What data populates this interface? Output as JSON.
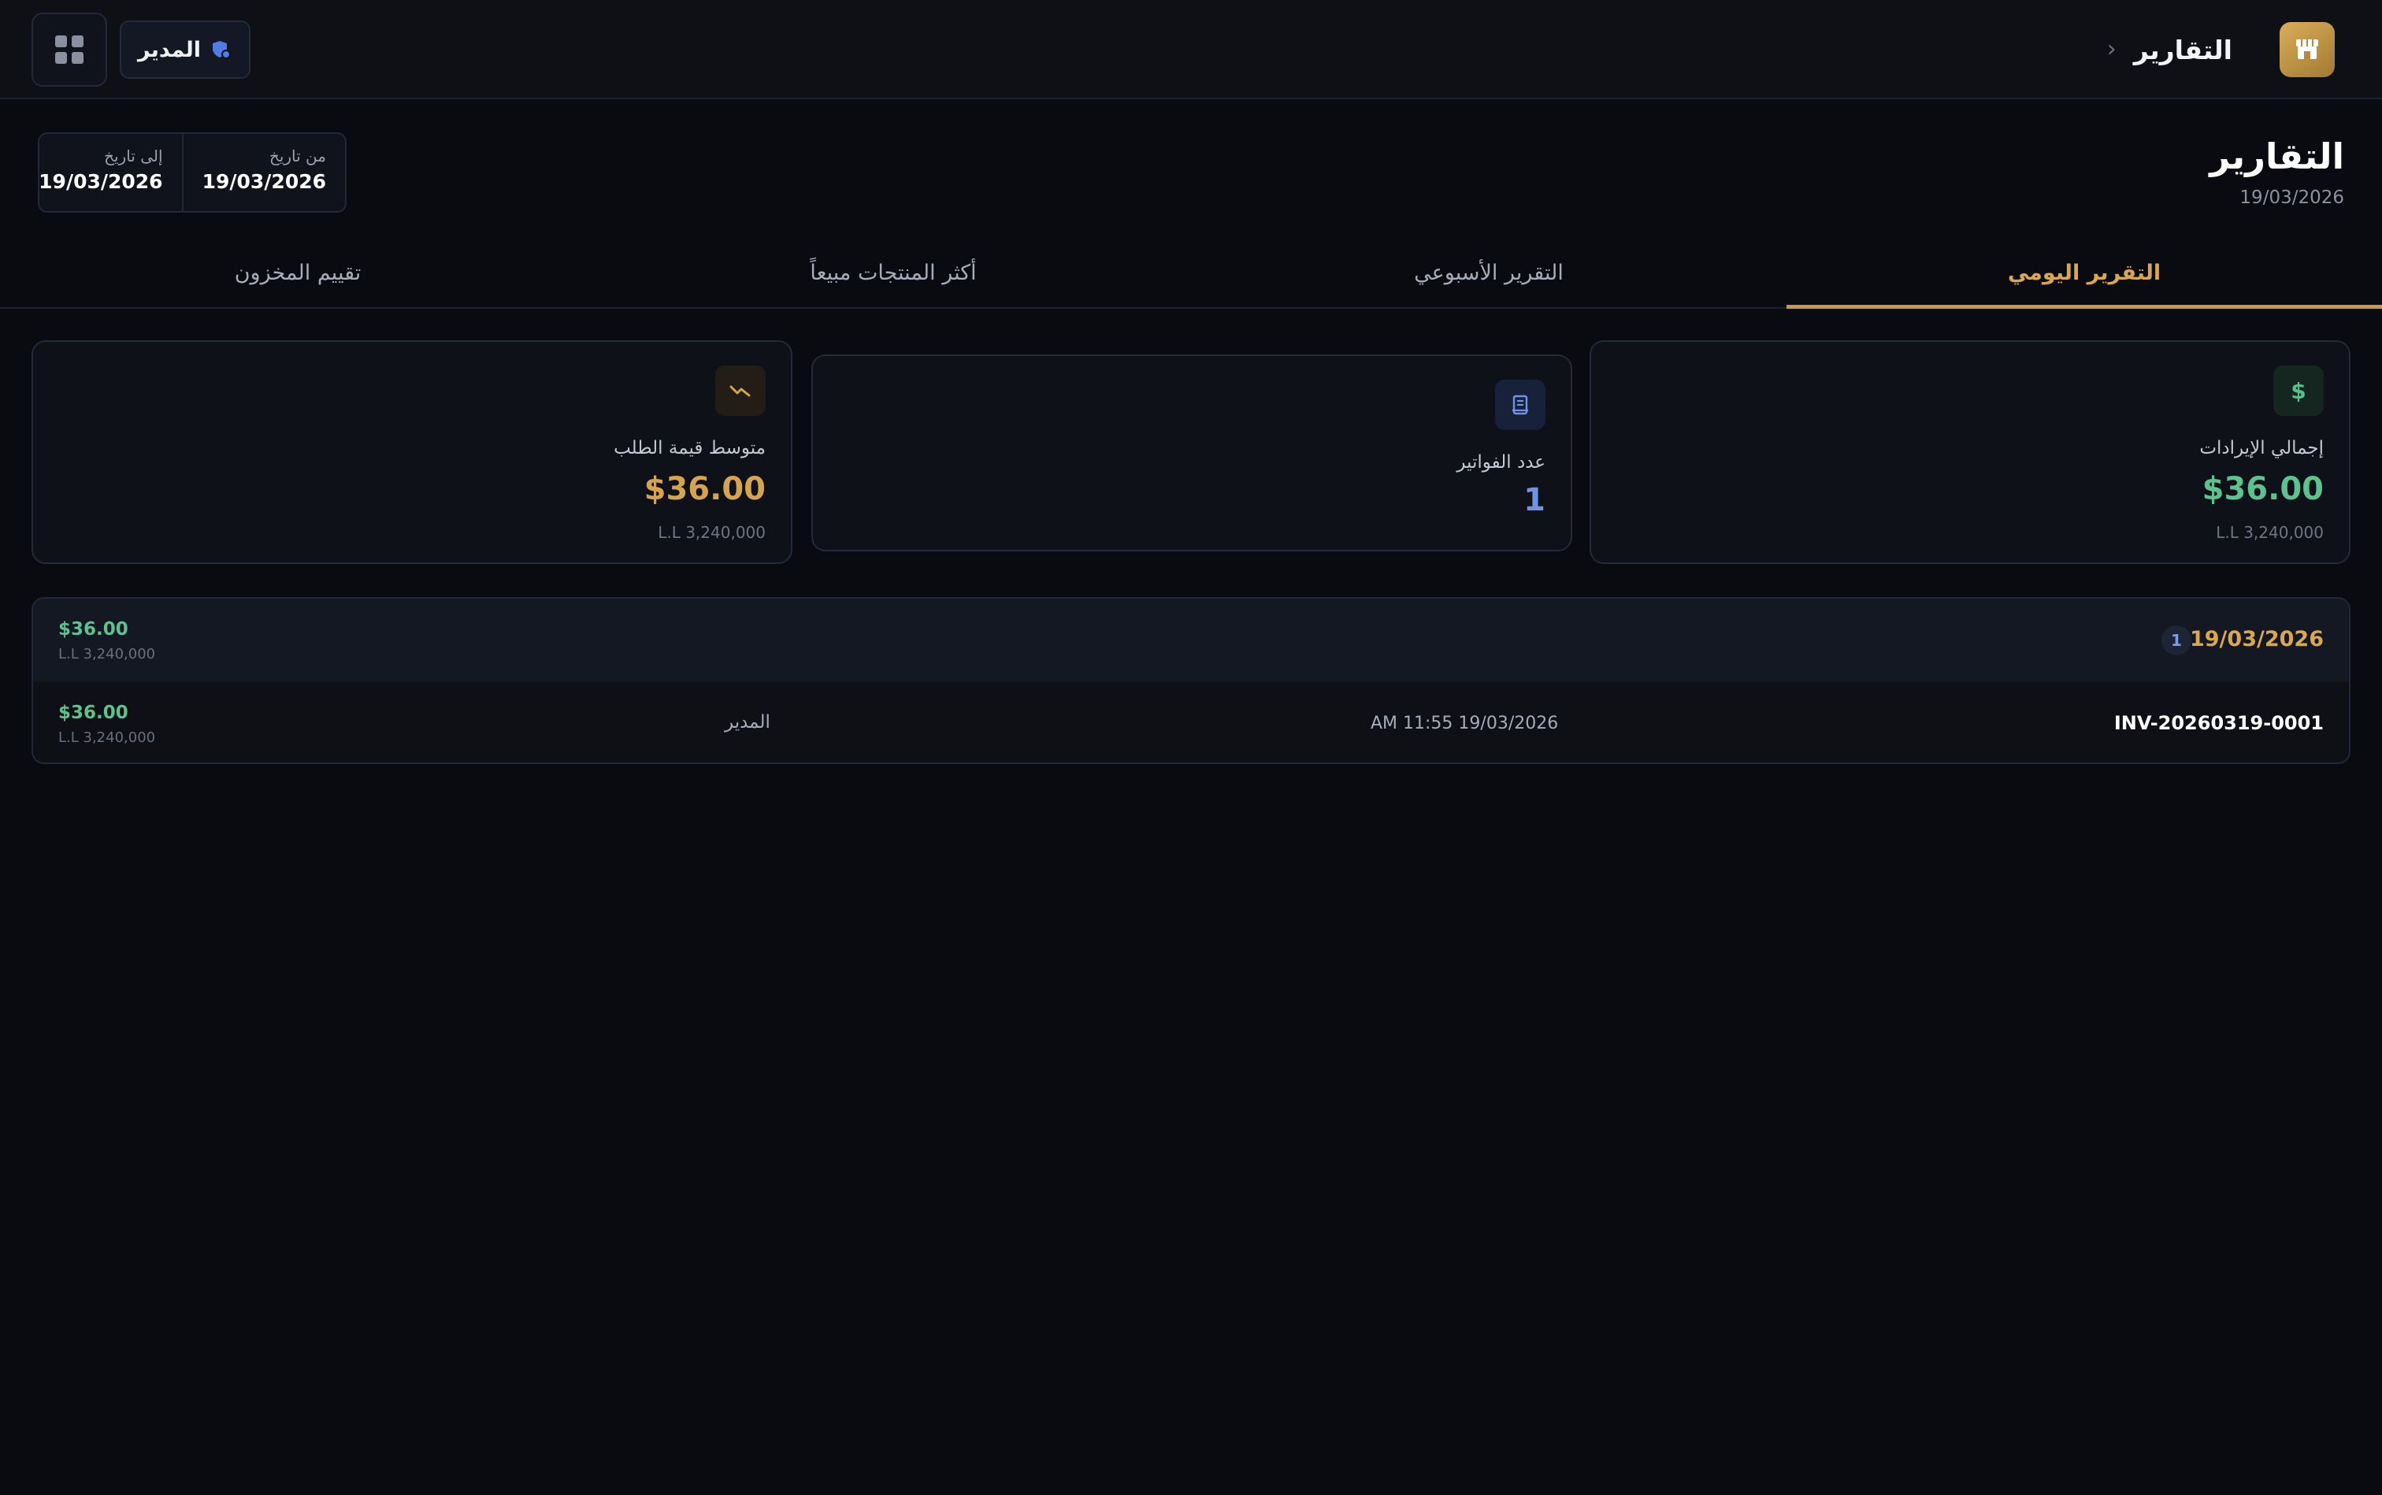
{
  "topbar": {
    "breadcrumb_title": "التقارير",
    "user_label": "المدير",
    "icons": {
      "grid": "grid-icon",
      "user": "shield-user-icon",
      "store": "store-icon",
      "chevron": "chevron-left-icon"
    }
  },
  "header": {
    "title": "التقارير",
    "date": "19/03/2026",
    "from_caption": "من تاريخ",
    "from_value": "19/03/2026",
    "to_caption": "إلى تاريخ",
    "to_value": "19/03/2026"
  },
  "tabs": [
    {
      "label": "التقرير اليومي",
      "active": true
    },
    {
      "label": "التقرير الأسبوعي",
      "active": false
    },
    {
      "label": "أكثر المنتجات مبيعاً",
      "active": false
    },
    {
      "label": "تقييم المخزون",
      "active": false
    }
  ],
  "stats": {
    "revenue": {
      "label": "إجمالي الإيرادات",
      "value": "$36.00",
      "sub": "L.L 3,240,000",
      "icon": "dollar-icon"
    },
    "invoices": {
      "label": "عدد الفواتير",
      "value": "1",
      "icon": "receipt-icon"
    },
    "average": {
      "label": "متوسط قيمة الطلب",
      "value": "$36.00",
      "sub": "L.L 3,240,000",
      "icon": "trend-icon"
    }
  },
  "day_group": {
    "date": "19/03/2026",
    "count": "1",
    "total_usd": "$36.00",
    "total_lbp": "L.L 3,240,000",
    "invoices": [
      {
        "number": "INV-20260319-0001",
        "datetime": "AM 11:55 19/03/2026",
        "user": "المدير",
        "usd": "$36.00",
        "lbp": "L.L 3,240,000"
      }
    ]
  },
  "colors": {
    "accent_gold": "#d9a84e",
    "revenue_green": "#5cc28e",
    "invoice_blue": "#6f93e6",
    "background": "#090b10"
  }
}
